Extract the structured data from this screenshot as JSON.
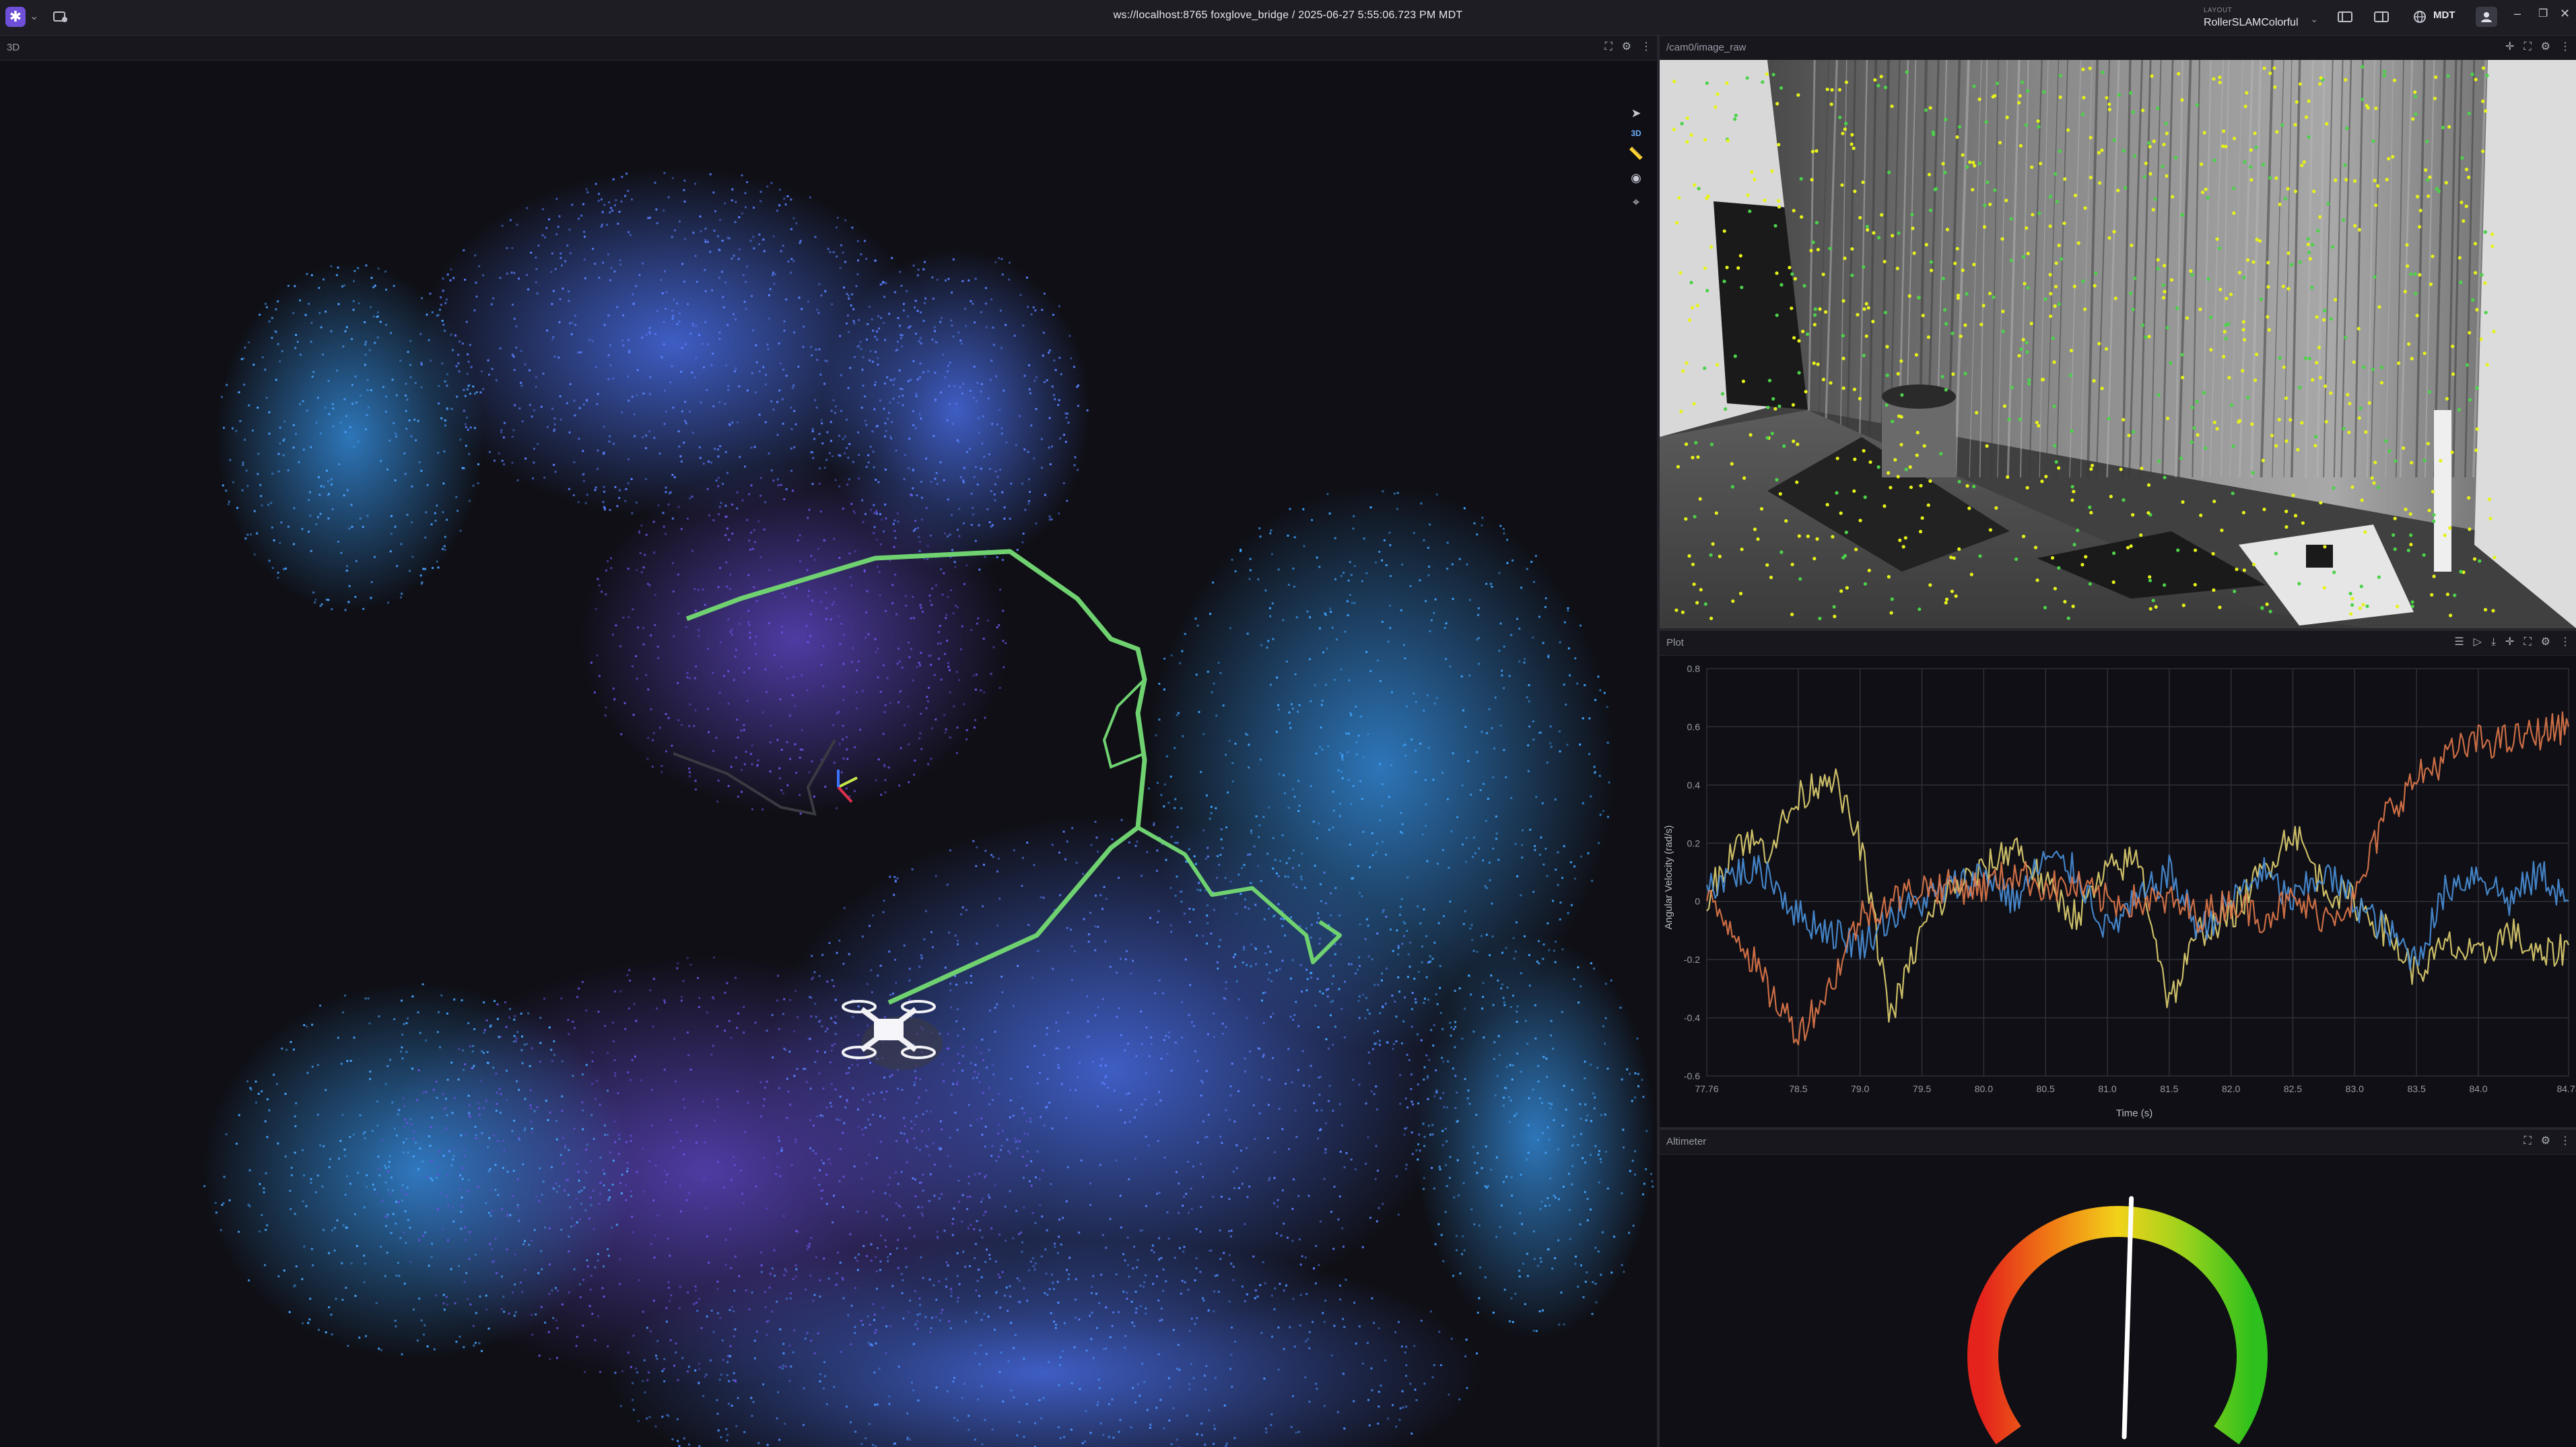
{
  "topbar": {
    "app_icon": "foxglove-logo-icon",
    "connection_url": "ws://localhost:8765",
    "connection_name": "foxglove_bridge",
    "separator": "/",
    "timestamp": "2025-06-27 5:55:06.723 PM MDT",
    "layout_caption": "LAYOUT",
    "layout_name": "RollerSLAMColorful",
    "timezone": "MDT"
  },
  "panel_3d": {
    "title": "3D",
    "toolbar_mode_label": "3D"
  },
  "panel_image": {
    "title": "/cam0/image_raw"
  },
  "panel_plot": {
    "title": "Plot",
    "chart_data": {
      "type": "line",
      "title": "",
      "xlabel": "Time (s)",
      "ylabel": "Angular Velocity (rad/s)",
      "xlim": [
        77.76,
        84.73
      ],
      "ylim": [
        -0.6,
        0.8
      ],
      "x_tick_labels": [
        "77.76",
        "78.5",
        "79.0",
        "79.5",
        "80.0",
        "80.5",
        "81.0",
        "81.5",
        "82.0",
        "82.5",
        "83.0",
        "83.5",
        "84.0",
        "84.73"
      ],
      "y_tick_labels": [
        "0.8",
        "0.6",
        "0.4",
        "0.2",
        "0",
        "-0.2",
        "-0.4",
        "-0.6"
      ],
      "grid": true,
      "legend": "none",
      "series": [
        {
          "color": "#e0d070",
          "x": [
            77.76,
            78.0,
            78.25,
            78.5,
            78.75,
            79.0,
            79.25,
            79.5,
            79.75,
            80.0,
            80.25,
            80.5,
            80.75,
            81.0,
            81.25,
            81.5,
            81.75,
            82.0,
            82.25,
            82.5,
            82.75,
            83.0,
            83.25,
            83.5,
            83.75,
            84.0,
            84.25,
            84.5,
            84.73
          ],
          "values": [
            0.0,
            0.22,
            0.18,
            0.35,
            0.45,
            0.2,
            -0.4,
            -0.1,
            0.05,
            0.1,
            0.2,
            0.05,
            -0.05,
            0.1,
            0.15,
            -0.35,
            -0.1,
            -0.05,
            0.1,
            0.25,
            0.05,
            0.0,
            -0.1,
            -0.25,
            -0.15,
            -0.2,
            -0.1,
            -0.2,
            -0.15
          ]
        },
        {
          "color": "#4a90d9",
          "x": [
            77.76,
            78.0,
            78.25,
            78.5,
            78.75,
            79.0,
            79.25,
            79.5,
            79.75,
            80.0,
            80.25,
            80.5,
            80.75,
            81.0,
            81.25,
            81.5,
            81.75,
            82.0,
            82.25,
            82.5,
            82.75,
            83.0,
            83.25,
            83.5,
            83.75,
            84.0,
            84.25,
            84.5,
            84.73
          ],
          "values": [
            0.05,
            0.1,
            0.1,
            -0.05,
            -0.1,
            -0.15,
            -0.05,
            0.0,
            0.05,
            0.1,
            0.0,
            0.15,
            0.1,
            -0.1,
            0.0,
            0.1,
            -0.1,
            0.0,
            0.1,
            0.0,
            0.1,
            0.0,
            -0.1,
            -0.2,
            0.05,
            0.1,
            0.0,
            0.1,
            0.0
          ]
        },
        {
          "color": "#e0784a",
          "x": [
            77.76,
            78.0,
            78.25,
            78.5,
            78.75,
            79.0,
            79.25,
            79.5,
            79.75,
            80.0,
            80.25,
            80.5,
            80.75,
            81.0,
            81.25,
            81.5,
            81.75,
            82.0,
            82.25,
            82.5,
            82.75,
            83.0,
            83.25,
            83.5,
            83.75,
            84.0,
            84.25,
            84.5,
            84.73
          ],
          "values": [
            0.0,
            -0.1,
            -0.3,
            -0.45,
            -0.3,
            -0.05,
            0.0,
            0.05,
            0.05,
            0.05,
            0.1,
            0.05,
            0.05,
            0.0,
            0.0,
            0.0,
            -0.05,
            0.0,
            -0.05,
            0.0,
            -0.05,
            0.0,
            0.3,
            0.42,
            0.5,
            0.55,
            0.55,
            0.58,
            0.6
          ]
        }
      ]
    }
  },
  "panel_altimeter": {
    "title": "Altimeter",
    "gauge_value_fraction": 0.52
  }
}
